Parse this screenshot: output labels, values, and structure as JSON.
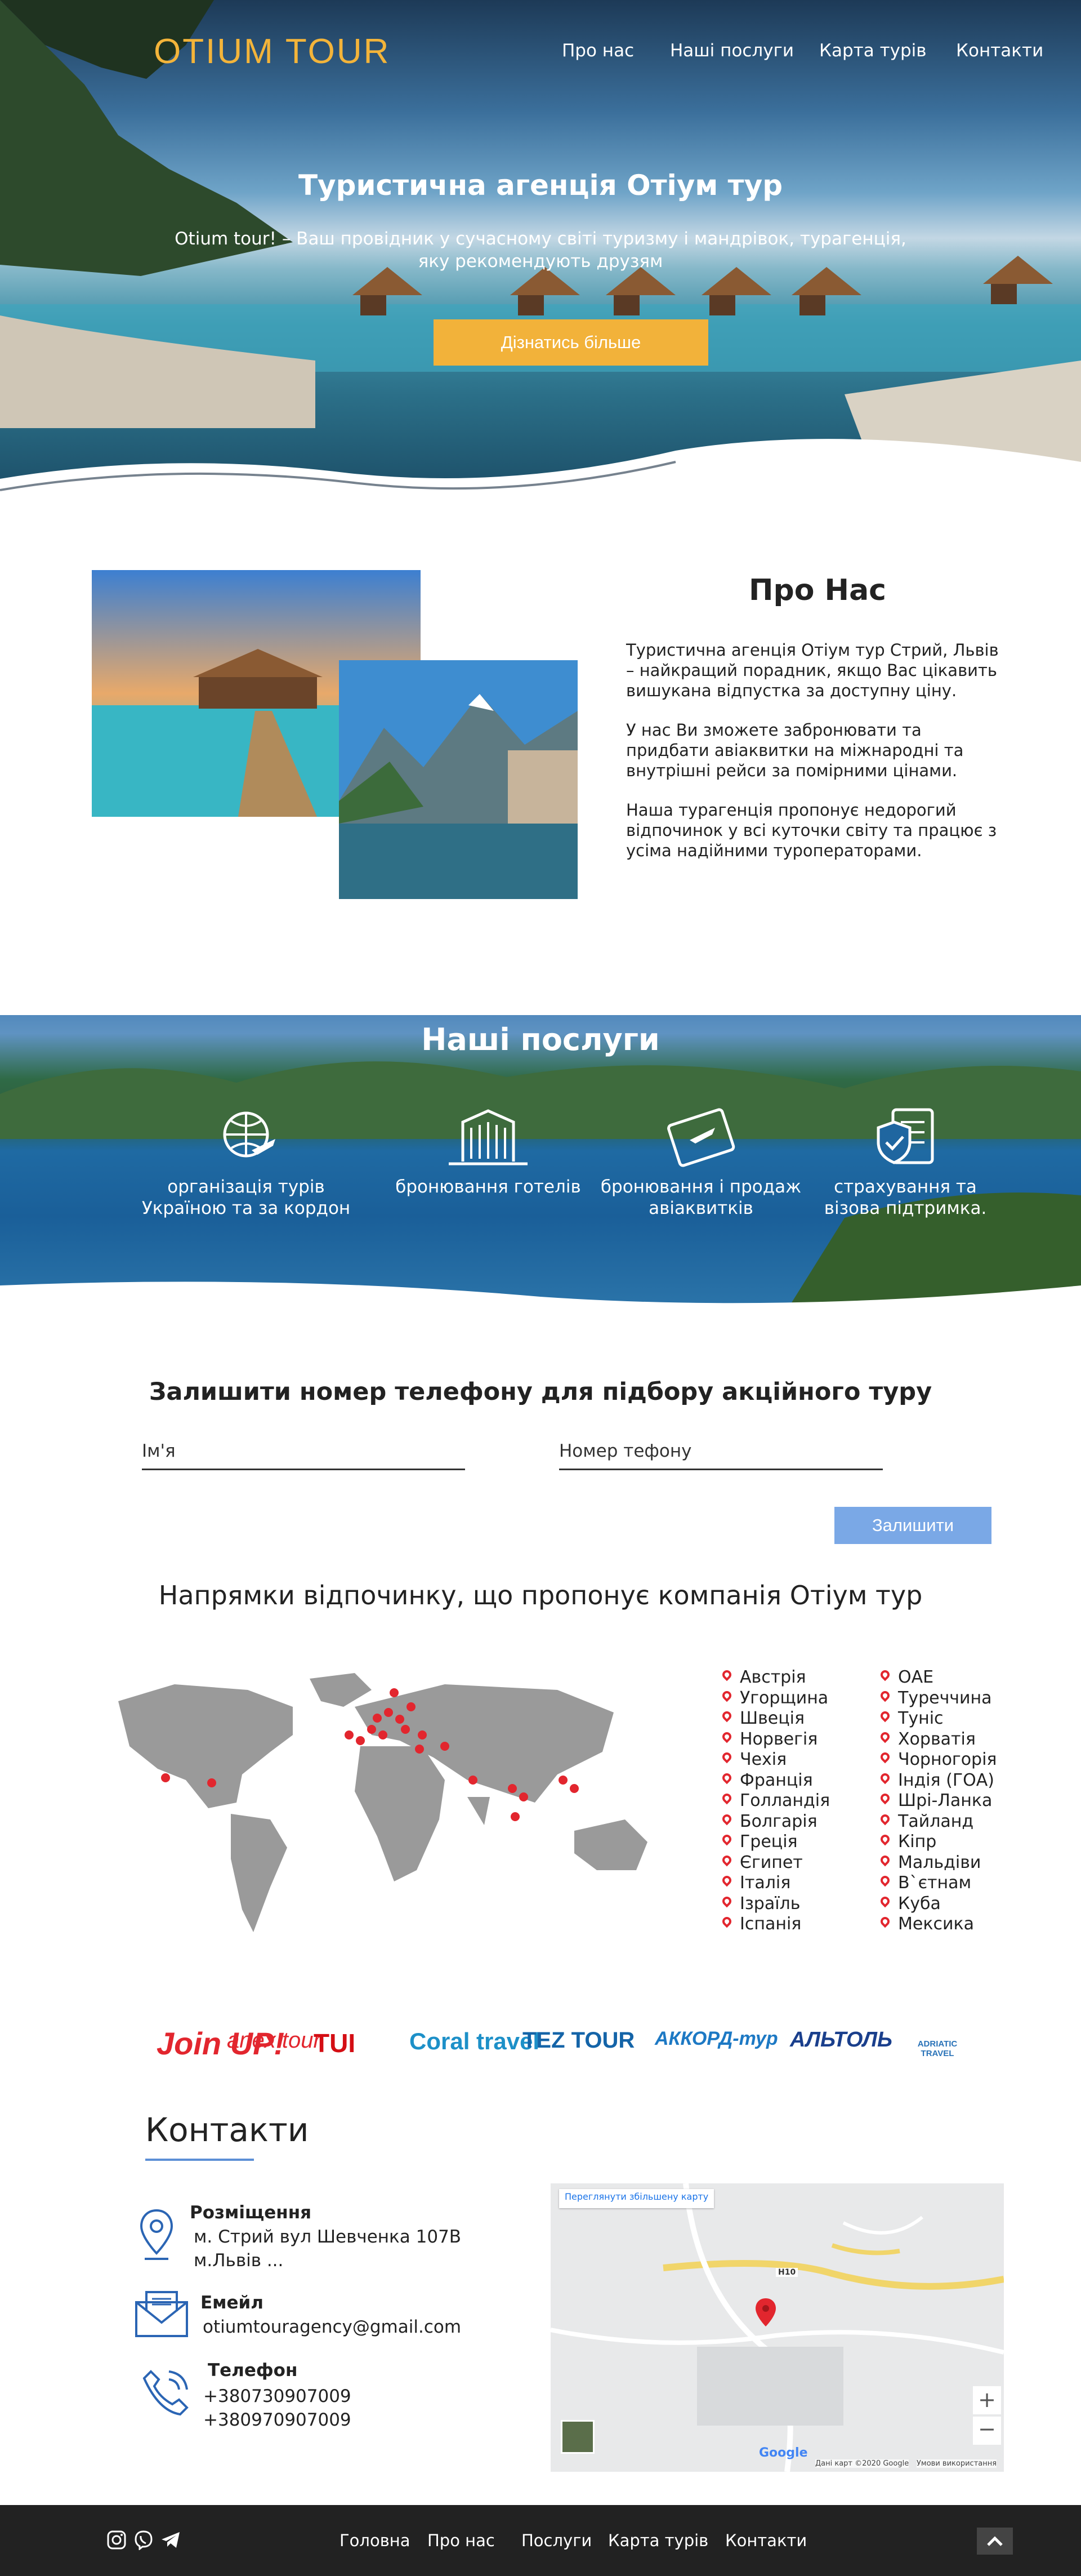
{
  "brand": {
    "logo": "OTIUM TOUR",
    "accent": "#f2b23a"
  },
  "nav": {
    "items": [
      "Про нас",
      "Наші послуги",
      "Карта турів",
      "Контакти"
    ]
  },
  "hero": {
    "title": "Туристична агенція Отіум тур",
    "subtitle_line1": "Otium tour! –  Ваш провідник у сучасному світі туризму і мандрівок, турагенція,",
    "subtitle_line2": "яку рекомендують друзям",
    "cta": "Дізнатись більше"
  },
  "about": {
    "title": "Про Нас",
    "p1": "Туристична агенція Отіум тур Стрий, Львів – найкращий порадник, якщо Вас цікавить вишукана відпустка за доступну ціну.",
    "p2": "У нас Ви зможете забронювати та придбати авіаквитки на міжнародні та внутрішні рейси за помірними цінами.",
    "p3": "Наша турагенція пропонує недорогий відпочинок у всі куточки світу та працює з усіма надійними туроператорами."
  },
  "services": {
    "title": "Наші послуги",
    "items": [
      {
        "icon": "globe-plane-icon",
        "line1": "організація турів",
        "line2": "Україною та за кордон"
      },
      {
        "icon": "hotel-building-icon",
        "line1": "бронювання готелів",
        "line2": ""
      },
      {
        "icon": "plane-ticket-icon",
        "line1": "бронювання і продаж",
        "line2": "авіаквитків"
      },
      {
        "icon": "insurance-document-icon",
        "line1": "страхування та",
        "line2": "візова підтримка."
      }
    ]
  },
  "callback": {
    "title": "Залишити номер телефону для підбору акційного туру",
    "name_placeholder": "Ім'я",
    "phone_placeholder": "Номер тефону",
    "submit": "Залишити",
    "submit_color": "#7aa8e6"
  },
  "destinations": {
    "title": "Напрямки відпочинку, що пропонує компанія Отіум тур",
    "col1": [
      "Австрія",
      "Угорщина",
      "Швеція",
      "Норвегія",
      "Чехія",
      "Франція",
      "Голландія",
      "Болгарія",
      "Греція",
      "Єгипет",
      "Італія",
      "Ізраїль",
      "Іспанія"
    ],
    "col2": [
      "ОАЕ",
      "Туреччина",
      "Туніс",
      "Хорватія",
      "Чорногорія",
      "Індія (ГОА)",
      "Шрі-Ланка",
      "Тайланд",
      "Кіпр",
      "Мальдіви",
      "В`єтнам",
      "Куба",
      "Мексика"
    ]
  },
  "partners": {
    "items": [
      "Join UP!",
      "anex tour",
      "TUI",
      "Coral travel",
      "TEZ TOUR",
      "АККОРД-тур",
      "АЛЬТОЛЬ",
      "ADRIATIC TRAVEL"
    ]
  },
  "contacts": {
    "title": "Контакти",
    "location_label": "Розміщення",
    "location_line1": "м. Стрий вул Шевченка 107В",
    "location_line2": "м.Львів ...",
    "email_label": "Емейл",
    "email": "otiumtouragency@gmail.com",
    "phone_label": "Телефон",
    "phone1": "+380730907009",
    "phone2": "+380970907009",
    "map_link": "Переглянути збільшену карту",
    "map_attr": "Дані карт ©2020 Google",
    "map_terms": "Умови використання",
    "map_logo": "Google",
    "map_road": "H10"
  },
  "footer": {
    "links": [
      "Головна",
      "Про нас",
      "Послуги",
      "Карта турів",
      "Контакти"
    ]
  }
}
